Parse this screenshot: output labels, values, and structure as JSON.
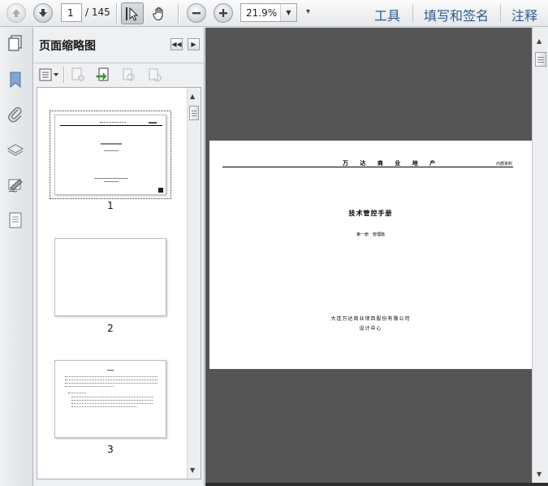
{
  "toolbar": {
    "current_page": "1",
    "page_total": "/ 145",
    "zoom": "21.9%",
    "menus": [
      "工具",
      "填写和签名",
      "注释"
    ]
  },
  "panel": {
    "title": "页面缩略图",
    "thumbnails": [
      {
        "label": "1"
      },
      {
        "label": "2"
      },
      {
        "label": "3"
      }
    ]
  },
  "document": {
    "header": "万 达 商 业 地 产",
    "header_right": "内部资料",
    "title": "技术管控手册",
    "subtitle": "第一册　管理篇",
    "company": "大连万达商业项目股份有限公司",
    "department": "设计中心"
  },
  "colors": {
    "menu_text": "#2c5c8f",
    "doc_background": "#555555",
    "toolbar_bg": "#e6e8eb"
  },
  "icons": [
    "prev-page-icon",
    "next-page-icon",
    "select-tool-icon",
    "hand-tool-icon",
    "zoom-out-icon",
    "zoom-in-icon",
    "bookmark-icon",
    "attachment-icon",
    "layers-icon",
    "signature-icon",
    "page-content-icon",
    "thumbnail-options-icon",
    "delete-page-icon",
    "insert-page-icon",
    "print-page-icon",
    "rotate-page-icon"
  ]
}
